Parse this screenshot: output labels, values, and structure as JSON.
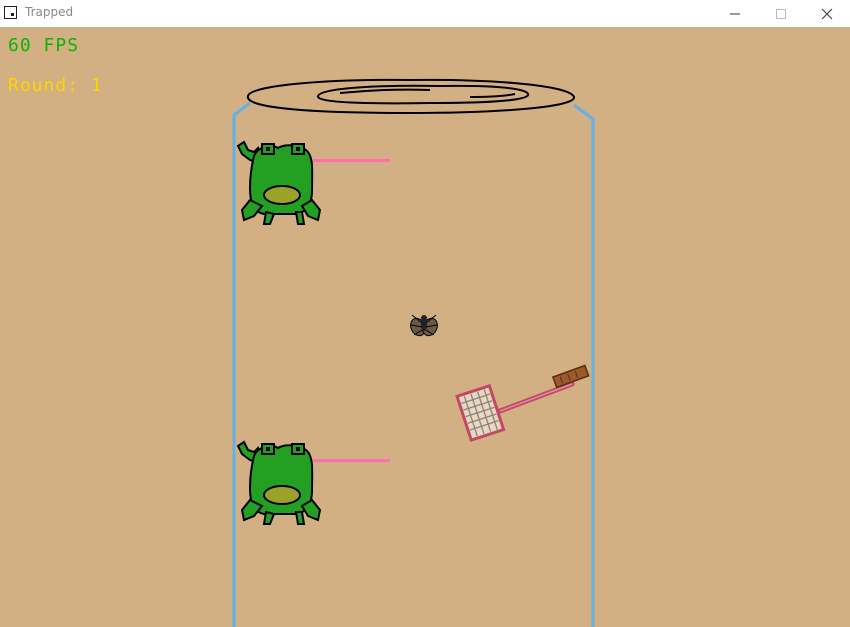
{
  "window": {
    "title": "Trapped",
    "controls": [
      "minimize",
      "maximize",
      "close"
    ]
  },
  "hud": {
    "fps_value": "60",
    "fps_unit": "FPS",
    "round_label": "Round:",
    "round_value": "1"
  },
  "colors": {
    "background": "#d3b084",
    "jar_outline": "#62b0e8",
    "fps_text": "#0cb400",
    "round_text": "#ffd400",
    "frog_body": "#23a021",
    "frog_belly": "#9aa22a",
    "frog_tongue": "#ff6fb0",
    "swatter_handle": "#c04a66",
    "swatter_grip": "#9b5a2c",
    "swatter_mesh": "#e6d8c4"
  },
  "scene": {
    "icons": [
      "jar-lid-icon",
      "jar-icon",
      "frog-icon",
      "frog-icon",
      "fly-icon",
      "fly-swatter-icon"
    ]
  }
}
